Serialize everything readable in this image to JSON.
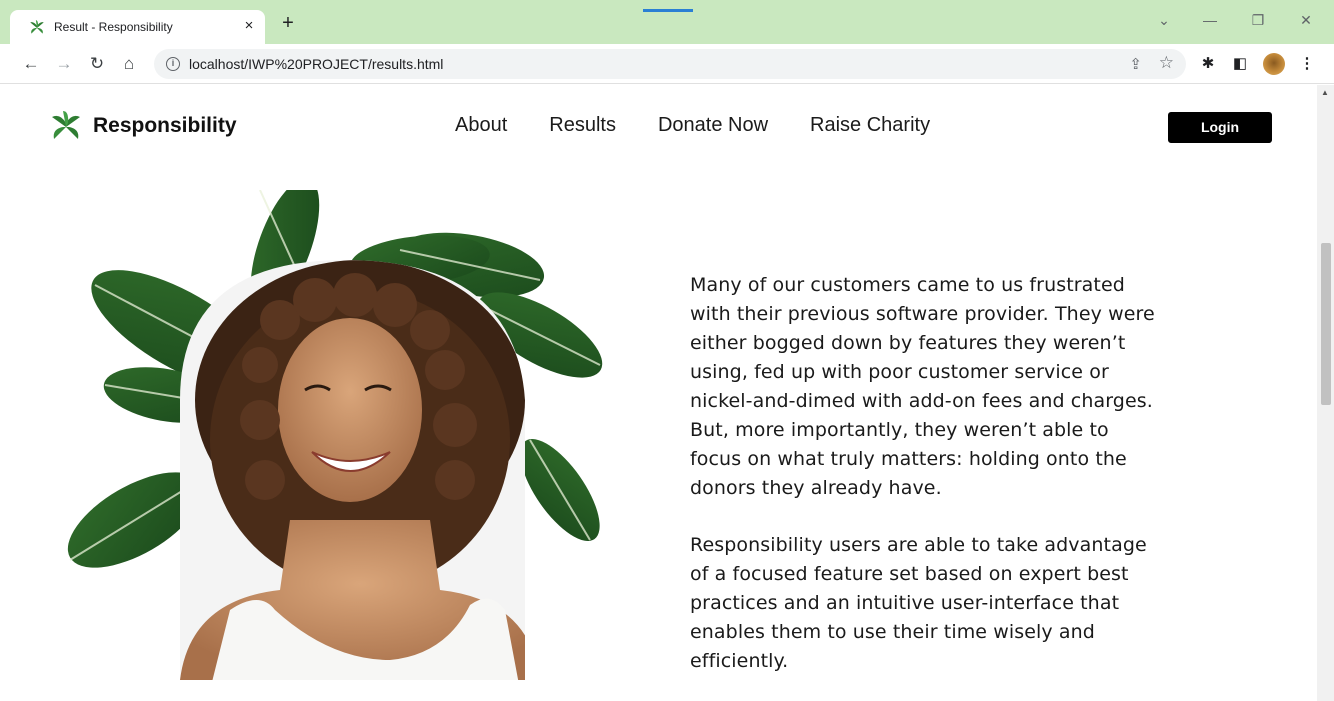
{
  "browser": {
    "tab_title": "Result - Responsibility",
    "tab_close": "×",
    "new_tab": "+",
    "url": "localhost/IWP%20PROJECT/results.html",
    "controls": {
      "chevron": "⌄",
      "minimize": "—",
      "restore": "❐",
      "close": "✕"
    },
    "icons": [
      "back-arrow-icon",
      "forward-arrow-icon",
      "reload-icon",
      "home-icon",
      "info-icon",
      "share-icon",
      "star-icon",
      "extensions-icon",
      "side-panel-icon",
      "profile-avatar",
      "menu-icon"
    ],
    "accent_color": "#c9e8bf"
  },
  "site": {
    "brand": "Responsibility",
    "brand_color": "#2e7d32",
    "nav": [
      "About",
      "Results",
      "Donate Now",
      "Raise Charity"
    ],
    "login": "Login"
  },
  "content": {
    "paragraph1": "Many of our customers came to us frustrated with their previous software provider. They were either bogged down by features they weren’t using, fed up with poor customer service or nickel-and-dimed with add-on fees and charges. But, more importantly, they weren’t able to focus on what truly matters: holding onto the donors they already have.",
    "paragraph2": "Responsibility users are able to take advantage of a focused feature set based on expert best practices and an intuitive user-interface that enables them to use their time wisely and efficiently."
  }
}
